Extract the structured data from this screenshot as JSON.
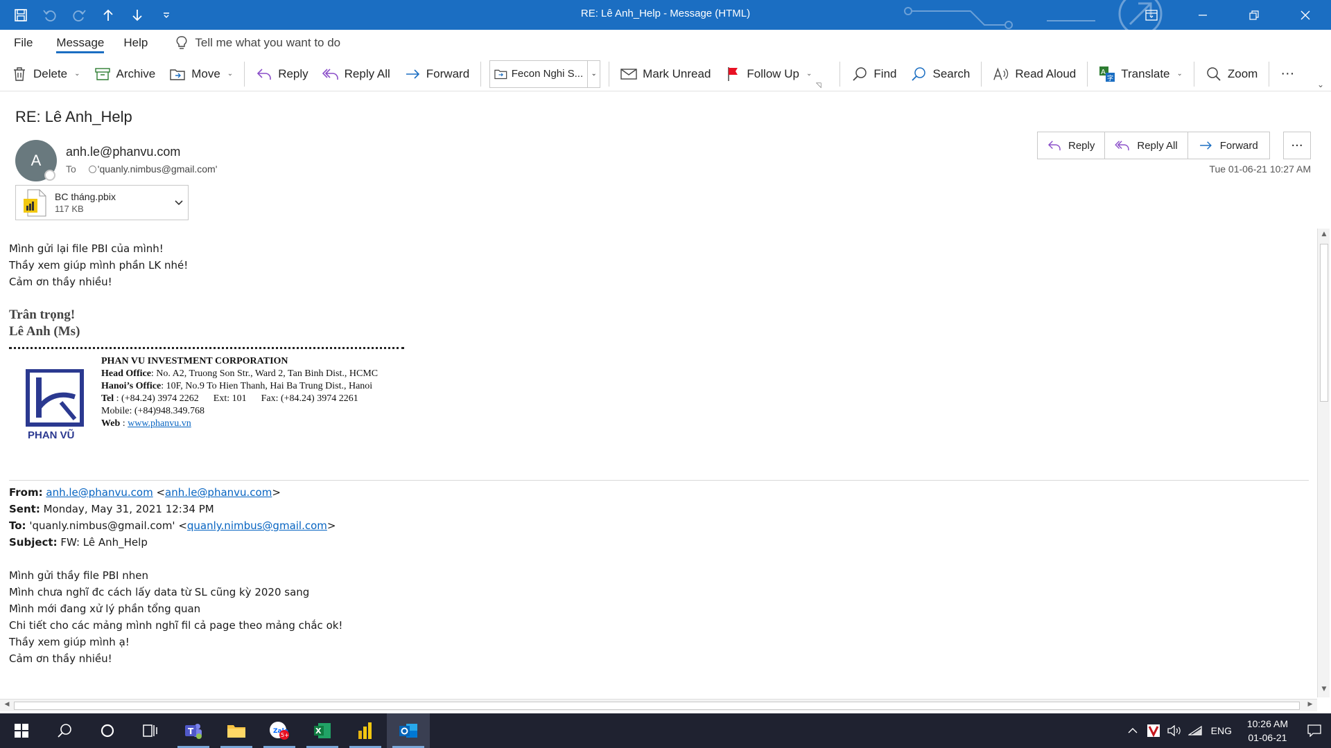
{
  "window": {
    "title": "RE: Lê Anh_Help  -  Message (HTML)"
  },
  "tabs": [
    "File",
    "Message",
    "Help"
  ],
  "tell_me": "Tell me what you want to do",
  "ribbon": {
    "delete": "Delete",
    "archive": "Archive",
    "move": "Move",
    "reply": "Reply",
    "reply_all": "Reply All",
    "forward": "Forward",
    "quick_step": "Fecon Nghi S...",
    "mark_unread": "Mark Unread",
    "follow_up": "Follow Up",
    "find": "Find",
    "search": "Search",
    "read_aloud": "Read Aloud",
    "translate": "Translate",
    "zoom": "Zoom",
    "more": "···"
  },
  "message": {
    "subject": "RE: Lê Anh_Help",
    "avatar_initial": "A",
    "from": "anh.le@phanvu.com",
    "to_label": "To",
    "to": "'quanly.nimbus@gmail.com'",
    "date": "Tue 01-06-21 10:27 AM",
    "actions": {
      "reply": "Reply",
      "reply_all": "Reply All",
      "forward": "Forward",
      "more": "···"
    },
    "attachment": {
      "name": "BC tháng.pbix",
      "size": "117 KB"
    }
  },
  "body": {
    "lines": [
      "Mình gửi lại file PBI của mình!",
      "Thầy xem giúp mình phần LK nhé!",
      "Cảm ơn thầy nhiều!"
    ],
    "closing": "Trân trọng!",
    "signature": "Lê Anh (Ms)",
    "logo_text": "PHAN VŨ",
    "corp": {
      "name": "PHAN VU INVESTMENT CORPORATION",
      "head_label": "Head Office",
      "head": ": No. A2, Truong Son Str., Ward 2, Tan Binh Dist., HCMC",
      "hanoi_label": "Hanoi’s Office",
      "hanoi": ": 10F, No.9 To Hien Thanh, Hai Ba Trung Dist., Hanoi",
      "tel_label": "Tel",
      "tel": " : (+84.24) 3974 2262      Ext: 101      Fax: (+84.24) 3974 2261",
      "mobile": "Mobile: (+84)948.349.768",
      "web_label": "Web",
      "web_sep": " : ",
      "web": "www.phanvu.vn"
    },
    "quoted": {
      "from_label": "From:",
      "from_link": "anh.le@phanvu.com",
      "from_lt": " <",
      "from_link2": "anh.le@phanvu.com",
      "from_gt": ">",
      "sent_label": "Sent:",
      "sent": " Monday, May 31, 2021 12:34 PM",
      "to_label": "To:",
      "to": " 'quanly.nimbus@gmail.com' <",
      "to_link": "quanly.nimbus@gmail.com",
      "to_gt": ">",
      "subject_label": "Subject:",
      "subject": " FW: Lê Anh_Help",
      "lines": [
        "Mình gửi thầy file PBI nhen",
        "Mình chưa nghĩ đc cách lấy data từ SL cũng kỳ 2020 sang",
        "Mình mới đang xử lý phần tổng quan",
        "Chi tiết cho các mảng mình nghĩ fil cả page theo mảng chắc ok!",
        "Thầy xem giúp mình ạ!",
        "Cảm ơn thầy nhiều!"
      ]
    }
  },
  "taskbar": {
    "language": "ENG",
    "time": "10:26 AM",
    "date": "01-06-21",
    "zalo_badge": "5+"
  },
  "colors": {
    "titlebar": "#1b6ec2",
    "accent": "#1b6ec2",
    "link": "#0563c1",
    "taskbar": "#1f2230"
  }
}
